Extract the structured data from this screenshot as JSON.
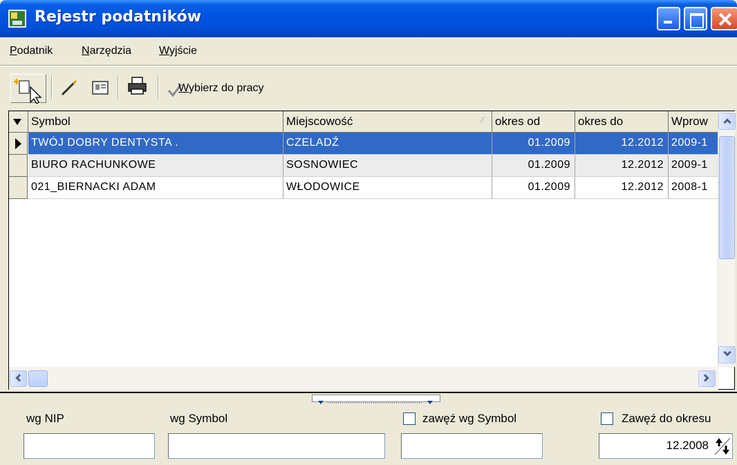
{
  "window": {
    "title": "Rejestr podatników"
  },
  "menu": [
    {
      "acc": "P",
      "rest": "odatnik"
    },
    {
      "acc": "N",
      "rest": "arzędzia"
    },
    {
      "acc": "W",
      "rest": "yjście"
    }
  ],
  "toolbar": {
    "select_acc": "W",
    "select_rest": "ybierz do pracy",
    "icons": [
      "new-icon",
      "edit-pencil-icon",
      "card-icon",
      "printer-icon",
      "checkmark-icon"
    ]
  },
  "grid": {
    "columns": [
      "Symbol",
      "Miejscowość",
      "okres od",
      "okres do",
      "Wprow"
    ],
    "rows": [
      {
        "symbol": "TWÓJ DOBRY DENTYSTA .",
        "city": "CZELADŹ",
        "from": "01.2009",
        "to": "12.2012",
        "entered": "2009-1"
      },
      {
        "symbol": "BIURO RACHUNKOWE",
        "city": "SOSNOWIEC",
        "from": "01.2009",
        "to": "12.2012",
        "entered": "2009-1"
      },
      {
        "symbol": "021_BIERNACKI ADAM",
        "city": "WŁODOWICE",
        "from": "01.2009",
        "to": "12.2012",
        "entered": "2008-1"
      }
    ],
    "selected_row": 0,
    "sort_column": "Miejscowość"
  },
  "filters": {
    "nip_label": "wg NIP",
    "nip_value": "",
    "symbol_label": "wg Symbol",
    "symbol_value": "",
    "narrow_symbol_label": "zawęź wg Symbol",
    "narrow_symbol_checked": false,
    "narrow_symbol_value": "",
    "narrow_period_label": "Zawęź do okresu",
    "narrow_period_checked": false,
    "period_value": "12.2008"
  },
  "colors": {
    "selection": "#3169c6",
    "titlebar": "#0054e3",
    "face": "#ece9d8"
  }
}
